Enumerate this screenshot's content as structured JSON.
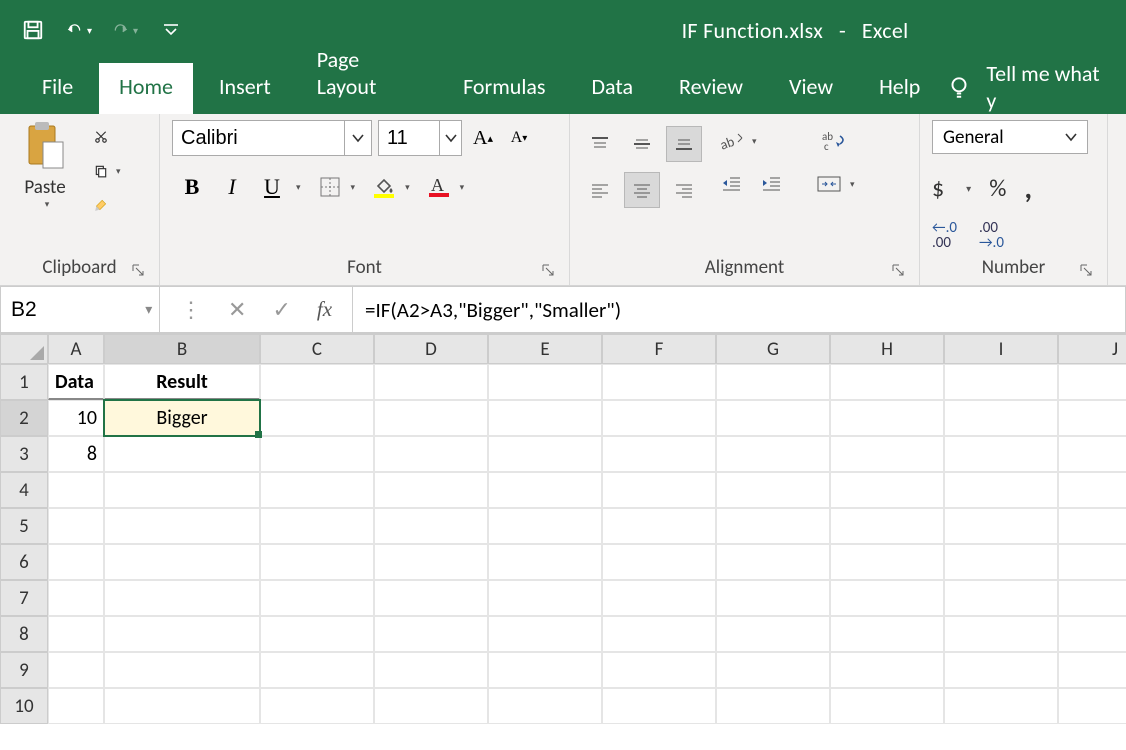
{
  "title": {
    "filename": "IF Function.xlsx",
    "sep": "-",
    "app": "Excel"
  },
  "tabs": {
    "file": "File",
    "home": "Home",
    "insert": "Insert",
    "page_layout": "Page Layout",
    "formulas": "Formulas",
    "data": "Data",
    "review": "Review",
    "view": "View",
    "help": "Help",
    "tell_me": "Tell me what y"
  },
  "ribbon": {
    "clipboard": {
      "paste": "Paste",
      "label": "Clipboard"
    },
    "font": {
      "name": "Calibri",
      "size": "11",
      "label": "Font"
    },
    "alignment": {
      "label": "Alignment"
    },
    "number": {
      "format": "General",
      "label": "Number",
      "currency": "$",
      "percent": "%",
      "comma": ",",
      "inc": "←.0\n.00",
      "dec": ".00\n→.0"
    }
  },
  "fx": {
    "name_box": "B2",
    "formula": "=IF(A2>A3,\"Bigger\",\"Smaller\")",
    "fx_label": "fx"
  },
  "grid": {
    "columns": [
      "A",
      "B",
      "C",
      "D",
      "E",
      "F",
      "G",
      "H",
      "I",
      "J"
    ],
    "rows": [
      "1",
      "2",
      "3",
      "4",
      "5",
      "6",
      "7",
      "8",
      "9",
      "10"
    ],
    "cells": {
      "A1": "Data",
      "B1": "Result",
      "A2": "10",
      "B2": "Bigger",
      "A3": "8"
    },
    "selected": "B2"
  }
}
